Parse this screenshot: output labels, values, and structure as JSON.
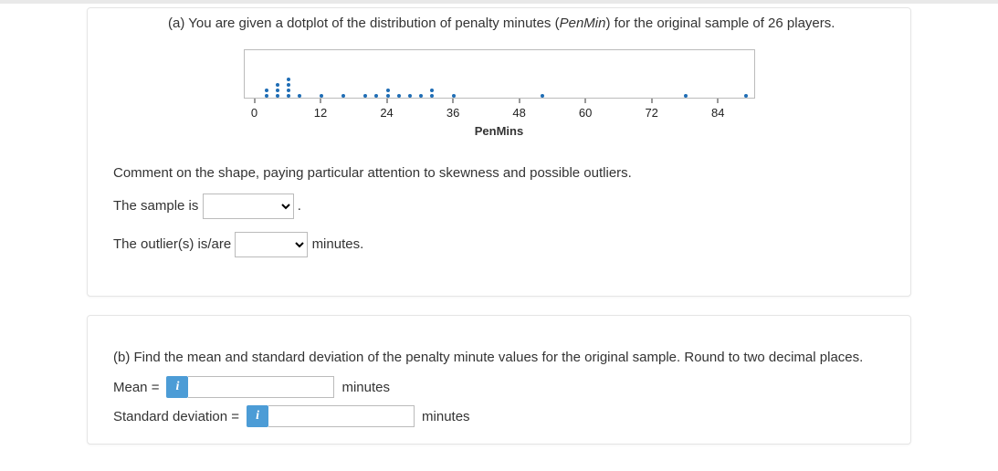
{
  "part_a": {
    "prompt_prefix": "(a) You are given a dotplot of the distribution of penalty minutes (",
    "prompt_var": "PenMin",
    "prompt_suffix": ") for the original sample of 26 players.",
    "comment_instruction": "Comment on the shape, paying particular attention to skewness and possible outliers.",
    "sample_is_label": "The sample is",
    "sample_is_period": ".",
    "outliers_label": "The outlier(s) is/are",
    "outliers_unit": "minutes."
  },
  "part_b": {
    "prompt": "(b) Find the mean and standard deviation of the penalty minute values for the original sample. Round to two decimal places.",
    "mean_label": "Mean =",
    "mean_unit": "minutes",
    "sd_label": "Standard deviation =",
    "sd_unit": "minutes",
    "info_icon_text": "i"
  },
  "chart_data": {
    "type": "dotplot",
    "xlabel": "PenMins",
    "x_ticks": [
      0,
      12,
      24,
      36,
      48,
      60,
      72,
      84
    ],
    "x_range": [
      0,
      90
    ],
    "series": [
      {
        "x": 2,
        "count": 2
      },
      {
        "x": 4,
        "count": 3
      },
      {
        "x": 6,
        "count": 4
      },
      {
        "x": 8,
        "count": 1
      },
      {
        "x": 12,
        "count": 1
      },
      {
        "x": 16,
        "count": 1
      },
      {
        "x": 20,
        "count": 1
      },
      {
        "x": 22,
        "count": 1
      },
      {
        "x": 24,
        "count": 2
      },
      {
        "x": 26,
        "count": 1
      },
      {
        "x": 28,
        "count": 1
      },
      {
        "x": 30,
        "count": 1
      },
      {
        "x": 32,
        "count": 2
      },
      {
        "x": 36,
        "count": 1
      },
      {
        "x": 52,
        "count": 1
      },
      {
        "x": 78,
        "count": 1
      },
      {
        "x": 89,
        "count": 1
      }
    ]
  }
}
